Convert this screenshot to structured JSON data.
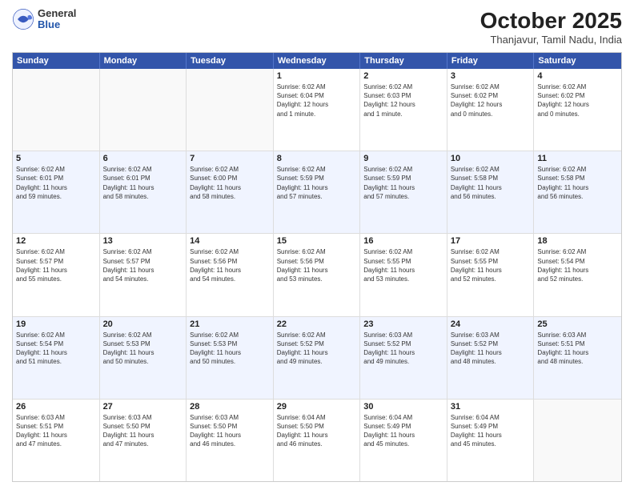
{
  "header": {
    "logo": {
      "general": "General",
      "blue": "Blue"
    },
    "title": "October 2025",
    "subtitle": "Thanjavur, Tamil Nadu, India"
  },
  "calendar": {
    "days_of_week": [
      "Sunday",
      "Monday",
      "Tuesday",
      "Wednesday",
      "Thursday",
      "Friday",
      "Saturday"
    ],
    "rows": [
      {
        "cells": [
          {
            "day": "",
            "info": "",
            "empty": true
          },
          {
            "day": "",
            "info": "",
            "empty": true
          },
          {
            "day": "",
            "info": "",
            "empty": true
          },
          {
            "day": "1",
            "info": "Sunrise: 6:02 AM\nSunset: 6:04 PM\nDaylight: 12 hours\nand 1 minute.",
            "empty": false
          },
          {
            "day": "2",
            "info": "Sunrise: 6:02 AM\nSunset: 6:03 PM\nDaylight: 12 hours\nand 1 minute.",
            "empty": false
          },
          {
            "day": "3",
            "info": "Sunrise: 6:02 AM\nSunset: 6:02 PM\nDaylight: 12 hours\nand 0 minutes.",
            "empty": false
          },
          {
            "day": "4",
            "info": "Sunrise: 6:02 AM\nSunset: 6:02 PM\nDaylight: 12 hours\nand 0 minutes.",
            "empty": false
          }
        ]
      },
      {
        "cells": [
          {
            "day": "5",
            "info": "Sunrise: 6:02 AM\nSunset: 6:01 PM\nDaylight: 11 hours\nand 59 minutes.",
            "empty": false
          },
          {
            "day": "6",
            "info": "Sunrise: 6:02 AM\nSunset: 6:01 PM\nDaylight: 11 hours\nand 58 minutes.",
            "empty": false
          },
          {
            "day": "7",
            "info": "Sunrise: 6:02 AM\nSunset: 6:00 PM\nDaylight: 11 hours\nand 58 minutes.",
            "empty": false
          },
          {
            "day": "8",
            "info": "Sunrise: 6:02 AM\nSunset: 5:59 PM\nDaylight: 11 hours\nand 57 minutes.",
            "empty": false
          },
          {
            "day": "9",
            "info": "Sunrise: 6:02 AM\nSunset: 5:59 PM\nDaylight: 11 hours\nand 57 minutes.",
            "empty": false
          },
          {
            "day": "10",
            "info": "Sunrise: 6:02 AM\nSunset: 5:58 PM\nDaylight: 11 hours\nand 56 minutes.",
            "empty": false
          },
          {
            "day": "11",
            "info": "Sunrise: 6:02 AM\nSunset: 5:58 PM\nDaylight: 11 hours\nand 56 minutes.",
            "empty": false
          }
        ]
      },
      {
        "cells": [
          {
            "day": "12",
            "info": "Sunrise: 6:02 AM\nSunset: 5:57 PM\nDaylight: 11 hours\nand 55 minutes.",
            "empty": false
          },
          {
            "day": "13",
            "info": "Sunrise: 6:02 AM\nSunset: 5:57 PM\nDaylight: 11 hours\nand 54 minutes.",
            "empty": false
          },
          {
            "day": "14",
            "info": "Sunrise: 6:02 AM\nSunset: 5:56 PM\nDaylight: 11 hours\nand 54 minutes.",
            "empty": false
          },
          {
            "day": "15",
            "info": "Sunrise: 6:02 AM\nSunset: 5:56 PM\nDaylight: 11 hours\nand 53 minutes.",
            "empty": false
          },
          {
            "day": "16",
            "info": "Sunrise: 6:02 AM\nSunset: 5:55 PM\nDaylight: 11 hours\nand 53 minutes.",
            "empty": false
          },
          {
            "day": "17",
            "info": "Sunrise: 6:02 AM\nSunset: 5:55 PM\nDaylight: 11 hours\nand 52 minutes.",
            "empty": false
          },
          {
            "day": "18",
            "info": "Sunrise: 6:02 AM\nSunset: 5:54 PM\nDaylight: 11 hours\nand 52 minutes.",
            "empty": false
          }
        ]
      },
      {
        "cells": [
          {
            "day": "19",
            "info": "Sunrise: 6:02 AM\nSunset: 5:54 PM\nDaylight: 11 hours\nand 51 minutes.",
            "empty": false
          },
          {
            "day": "20",
            "info": "Sunrise: 6:02 AM\nSunset: 5:53 PM\nDaylight: 11 hours\nand 50 minutes.",
            "empty": false
          },
          {
            "day": "21",
            "info": "Sunrise: 6:02 AM\nSunset: 5:53 PM\nDaylight: 11 hours\nand 50 minutes.",
            "empty": false
          },
          {
            "day": "22",
            "info": "Sunrise: 6:02 AM\nSunset: 5:52 PM\nDaylight: 11 hours\nand 49 minutes.",
            "empty": false
          },
          {
            "day": "23",
            "info": "Sunrise: 6:03 AM\nSunset: 5:52 PM\nDaylight: 11 hours\nand 49 minutes.",
            "empty": false
          },
          {
            "day": "24",
            "info": "Sunrise: 6:03 AM\nSunset: 5:52 PM\nDaylight: 11 hours\nand 48 minutes.",
            "empty": false
          },
          {
            "day": "25",
            "info": "Sunrise: 6:03 AM\nSunset: 5:51 PM\nDaylight: 11 hours\nand 48 minutes.",
            "empty": false
          }
        ]
      },
      {
        "cells": [
          {
            "day": "26",
            "info": "Sunrise: 6:03 AM\nSunset: 5:51 PM\nDaylight: 11 hours\nand 47 minutes.",
            "empty": false
          },
          {
            "day": "27",
            "info": "Sunrise: 6:03 AM\nSunset: 5:50 PM\nDaylight: 11 hours\nand 47 minutes.",
            "empty": false
          },
          {
            "day": "28",
            "info": "Sunrise: 6:03 AM\nSunset: 5:50 PM\nDaylight: 11 hours\nand 46 minutes.",
            "empty": false
          },
          {
            "day": "29",
            "info": "Sunrise: 6:04 AM\nSunset: 5:50 PM\nDaylight: 11 hours\nand 46 minutes.",
            "empty": false
          },
          {
            "day": "30",
            "info": "Sunrise: 6:04 AM\nSunset: 5:49 PM\nDaylight: 11 hours\nand 45 minutes.",
            "empty": false
          },
          {
            "day": "31",
            "info": "Sunrise: 6:04 AM\nSunset: 5:49 PM\nDaylight: 11 hours\nand 45 minutes.",
            "empty": false
          },
          {
            "day": "",
            "info": "",
            "empty": true
          }
        ]
      }
    ]
  },
  "colors": {
    "header_bg": "#3a5bbf",
    "alt_row": "#eef2ff"
  }
}
